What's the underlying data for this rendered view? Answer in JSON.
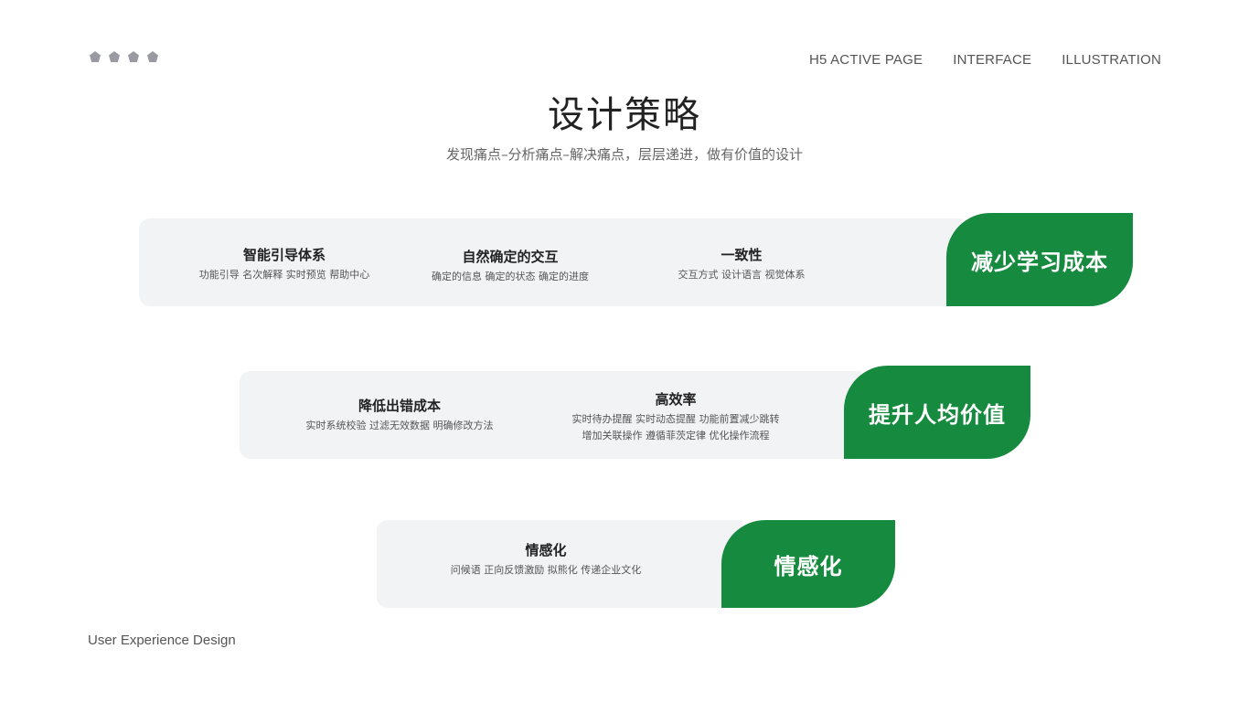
{
  "nav": {
    "items": [
      "H5 ACTIVE PAGE",
      "INTERFACE",
      "ILLUSTRATION"
    ]
  },
  "header": {
    "title": "设计策略",
    "subtitle": "发现痛点–分析痛点–解决痛点，层层递进，做有价值的设计"
  },
  "rows": [
    {
      "tag": "减少学习成本",
      "items": [
        {
          "title": "智能引导体系",
          "desc": [
            "功能引导  名次解释  实时预览  帮助中心"
          ]
        },
        {
          "title": "自然确定的交互",
          "desc": [
            "确定的信息  确定的状态  确定的进度"
          ]
        },
        {
          "title": "一致性",
          "desc": [
            "交互方式  设计语言  视觉体系"
          ]
        }
      ]
    },
    {
      "tag": "提升人均价值",
      "items": [
        {
          "title": "降低出错成本",
          "desc": [
            "实时系统校验   过滤无效数据  明确修改方法"
          ]
        },
        {
          "title": "高效率",
          "desc": [
            "实时待办提醒  实时动态提醒  功能前置减少跳转",
            "增加关联操作  遵循菲茨定律  优化操作流程"
          ]
        }
      ]
    },
    {
      "tag": "情感化",
      "items": [
        {
          "title": "情感化",
          "desc": [
            "问候语  正向反馈激励  拟熊化  传递企业文化"
          ]
        }
      ]
    }
  ],
  "footer": {
    "text": "User Experience Design"
  },
  "colors": {
    "accent": "#168a3e",
    "card_bg": "#f2f3f5",
    "text": "#222222"
  }
}
